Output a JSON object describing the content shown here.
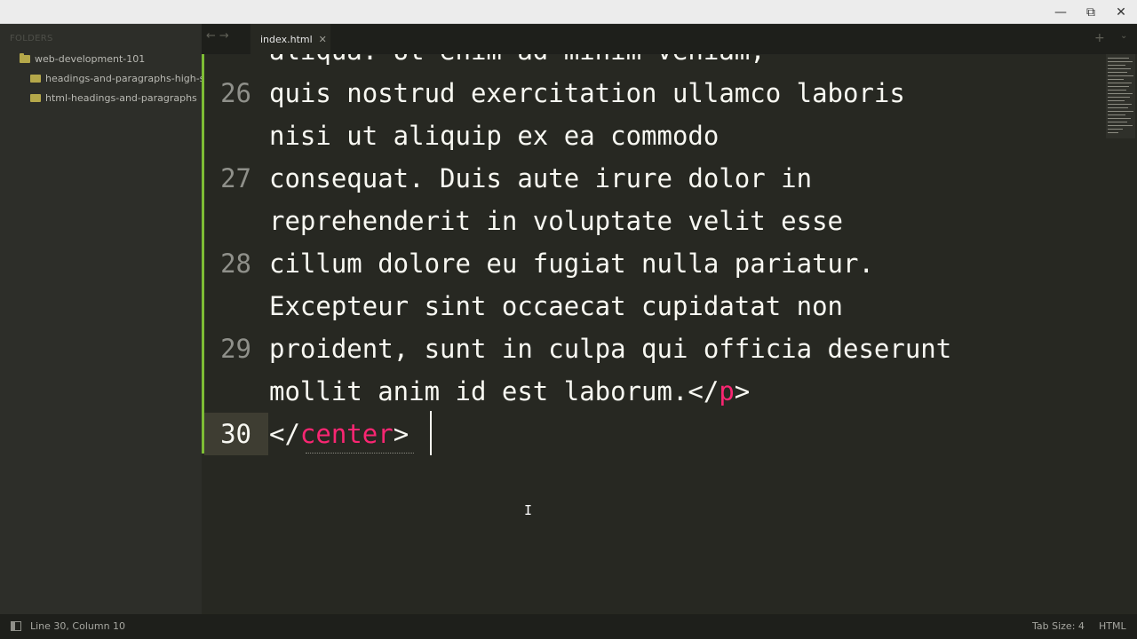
{
  "window": {
    "controls": {
      "minimize": "—",
      "restore": "⧉",
      "close": "✕"
    }
  },
  "sidebar": {
    "header": "FOLDERS",
    "items": [
      {
        "label": "web-development-101",
        "icon": "folder-open-icon"
      },
      {
        "label": "headings-and-paragraphs-high-sch",
        "icon": "folder-icon"
      },
      {
        "label": "html-headings-and-paragraphs",
        "icon": "folder-icon"
      }
    ]
  },
  "tabs": {
    "nav_back": "←",
    "nav_forward": "→",
    "active": {
      "label": "index.html",
      "close": "✕"
    },
    "new_tab": "+",
    "overflow": "⌄"
  },
  "editor": {
    "lines": [
      {
        "number": "",
        "text": "aliqua. Ut enim ad minim veniam,"
      },
      {
        "number": "26",
        "text": "quis nostrud exercitation ullamco laboris"
      },
      {
        "number": "",
        "text": "nisi ut aliquip ex ea commodo"
      },
      {
        "number": "27",
        "text": "consequat. Duis aute irure dolor in"
      },
      {
        "number": "",
        "text": "reprehenderit in voluptate velit esse"
      },
      {
        "number": "28",
        "text": "cillum dolore eu fugiat nulla pariatur."
      },
      {
        "number": "",
        "text": "Excepteur sint occaecat cupidatat non"
      },
      {
        "number": "29",
        "text": "proident, sunt in culpa qui officia deserunt"
      },
      {
        "number": "",
        "text_before": "mollit anim id est laborum.</",
        "tag": "p",
        "text_after": ">"
      },
      {
        "number": "30",
        "text_before": "</",
        "tag": "center",
        "text_after": ">"
      }
    ],
    "colors": {
      "background": "#272822",
      "text": "#f8f8f2",
      "tag": "#f92672",
      "gutter": "#8f908a",
      "modified_marker": "#7ebd35"
    }
  },
  "status": {
    "position": "Line 30, Column 10",
    "tab_size": "Tab Size: 4",
    "syntax": "HTML"
  }
}
